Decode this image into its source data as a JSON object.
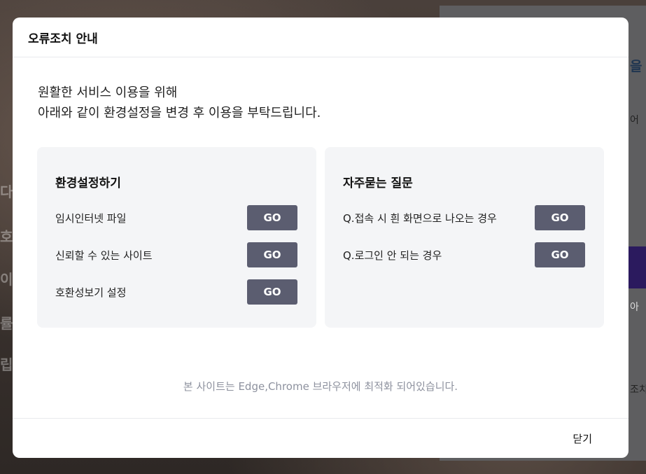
{
  "backdrop": {
    "fragments": [
      "다",
      "호",
      "이",
      "률",
      "립"
    ],
    "side_texts": [
      "을",
      "어",
      "아",
      "조치"
    ]
  },
  "modal": {
    "title": "오류조치 안내",
    "intro_lines": [
      "원활한 서비스 이용을 위해",
      "아래와 같이 환경설정을 변경 후 이용을 부탁드립니다."
    ],
    "settings_card": {
      "title": "환경설정하기",
      "items": [
        {
          "label": "임시인터넷 파일",
          "button": "GO"
        },
        {
          "label": "신뢰할 수 있는 사이트",
          "button": "GO"
        },
        {
          "label": "호환성보기 설정",
          "button": "GO"
        }
      ]
    },
    "faq_card": {
      "title": "자주묻는 질문",
      "items": [
        {
          "label": "Q.접속 시 흰 화면으로 나오는 경우",
          "button": "GO"
        },
        {
          "label": "Q.로그인 안 되는 경우",
          "button": "GO"
        }
      ]
    },
    "notice": "본 사이트는 Edge,Chrome 브라우저에 최적화 되어있습니다.",
    "close_label": "닫기"
  }
}
